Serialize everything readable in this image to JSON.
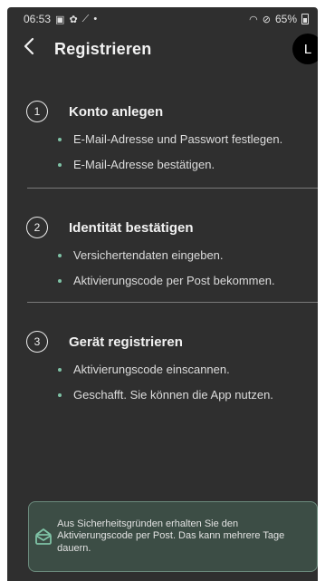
{
  "status_bar": {
    "time": "06:53",
    "battery": "65%"
  },
  "app_bar": {
    "back_icon": "chevron-left-icon",
    "title": "Registrieren",
    "avatar_letter": "L"
  },
  "steps": [
    {
      "number": "1",
      "title": "Konto anlegen",
      "items": [
        "E-Mail-Adresse und Passwort festlegen.",
        "E-Mail-Adresse bestätigen."
      ]
    },
    {
      "number": "2",
      "title": "Identität bestätigen",
      "items": [
        "Versichertendaten eingeben.",
        "Aktivierungscode per Post bekommen."
      ]
    },
    {
      "number": "3",
      "title": "Gerät registrieren",
      "items": [
        "Aktivierungscode einscannen.",
        "Geschafft. Sie können die App nutzen."
      ]
    }
  ],
  "info_box": {
    "icon": "mail-box-icon",
    "text": "Aus Sicherheitsgründen erhalten Sie den Aktivierungscode per Post. Das kann mehrere Tage dauern."
  },
  "colors": {
    "background": "#2f2f2f",
    "bullet": "#7fc3a6",
    "info_background": "#3c4d45",
    "info_border": "#6b8a7c"
  }
}
